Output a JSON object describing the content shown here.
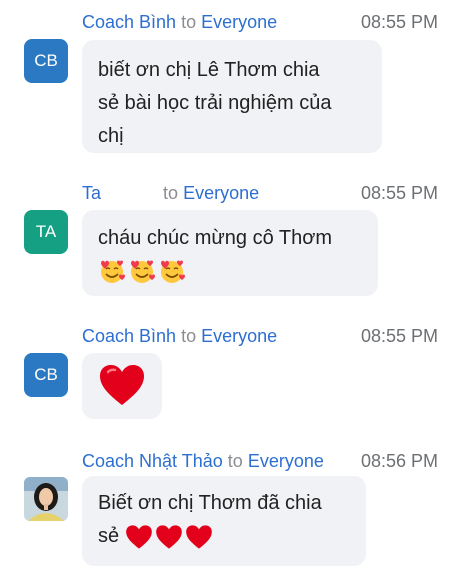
{
  "messages": [
    {
      "sender": "Coach Bình",
      "to_word": "to",
      "recipient": "Everyone",
      "time": "08:55 PM",
      "avatar_initials": "CB",
      "text_lines": [
        "biết ơn chị Lê Thơm chia",
        "sẻ bài học trải nghiệm của",
        "chị"
      ]
    },
    {
      "sender": "Ta",
      "to_word": "to",
      "recipient": "Everyone",
      "time": "08:55 PM",
      "avatar_initials": "TA",
      "text": "cháu chúc mừng cô Thơm",
      "emoji_icons": [
        "smiling-face-with-hearts-icon",
        "smiling-face-with-hearts-icon",
        "smiling-face-with-hearts-icon"
      ]
    },
    {
      "sender": "Coach Bình",
      "to_word": "to",
      "recipient": "Everyone",
      "time": "08:55 PM",
      "avatar_initials": "CB",
      "emoji_icons": [
        "red-heart-icon"
      ]
    },
    {
      "sender": "Coach Nhật Thảo",
      "to_word": "to",
      "recipient": "Everyone",
      "time": "08:56 PM",
      "avatar": "profile-photo",
      "text_lines": [
        "Biết ơn chị Thơm đã chia",
        "sẻ"
      ],
      "emoji_icons": [
        "red-heart-icon",
        "red-heart-icon",
        "red-heart-icon"
      ]
    }
  ],
  "colors": {
    "sender_link": "#2d6fd0",
    "bubble_bg": "#f1f2f5",
    "avatar_cb": "#2a79c2",
    "avatar_ta": "#16a083",
    "heart": "#e3001b"
  }
}
